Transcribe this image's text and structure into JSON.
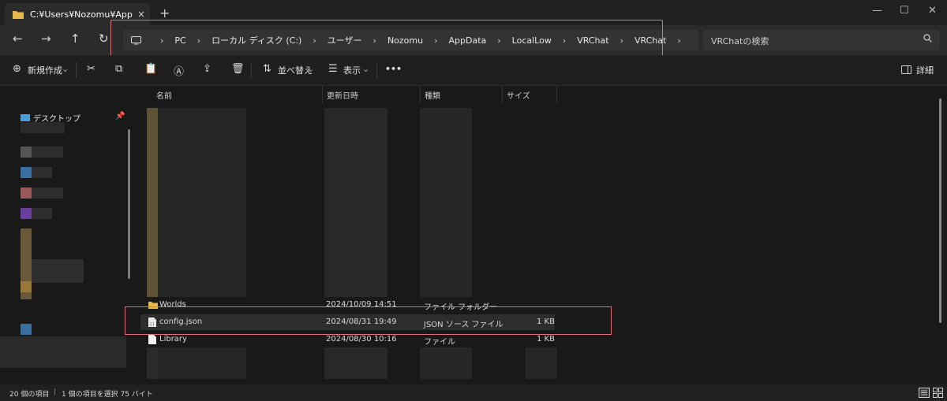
{
  "tab": {
    "title": "C:¥Users¥Nozomu¥AppData¥l",
    "close": "×",
    "new": "+"
  },
  "window_controls": {
    "minimize": "—",
    "maximize": "☐",
    "close": "✕"
  },
  "nav": {
    "back": "←",
    "forward": "→",
    "up": "↑",
    "refresh": "↻"
  },
  "breadcrumbs": [
    "PC",
    "ローカル ディスク (C:)",
    "ユーザー",
    "Nozomu",
    "AppData",
    "LocalLow",
    "VRChat",
    "VRChat"
  ],
  "breadcrumb_sep": "›",
  "search": {
    "placeholder": "VRChatの検索"
  },
  "commands": {
    "new": "新規作成",
    "sort": "並べ替え",
    "view": "表示",
    "more": "•••",
    "details": "詳細"
  },
  "navpane": {
    "desktop": "デスクトップ"
  },
  "columns": {
    "name": "名前",
    "modified": "更新日時",
    "type": "種類",
    "size": "サイズ"
  },
  "files": [
    {
      "name": "Worlds",
      "modified": "2024/10/09 14:51",
      "type": "ファイル フォルダー",
      "size": ""
    },
    {
      "name": "config.json",
      "modified": "2024/08/31 19:49",
      "type": "JSON ソース ファイル",
      "size": "1 KB"
    },
    {
      "name": "Library",
      "modified": "2024/08/30 10:16",
      "type": "ファイル",
      "size": "1 KB"
    }
  ],
  "status": {
    "count": "20 個の項目",
    "selected": "1 個の項目を選択  75 バイト"
  },
  "colors": {
    "accent_highlight": "#e0707c",
    "folder": "#e8b74a",
    "selected_row": "#2d2d2d"
  }
}
